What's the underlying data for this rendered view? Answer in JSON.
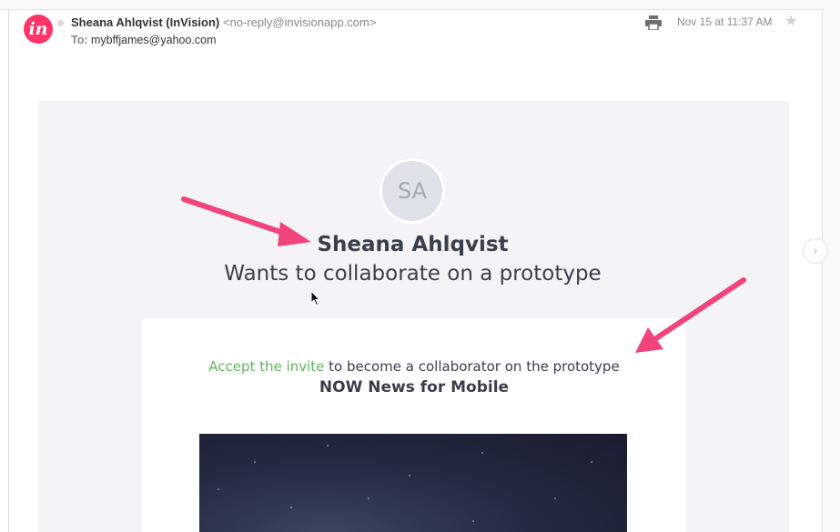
{
  "header": {
    "logo_text": "in",
    "sender_name": "Sheana Ahlqvist (InVision)",
    "sender_email": "<no-reply@invisionapp.com>",
    "to_label": "To:",
    "to_address": "mybffjames@yahoo.com",
    "date": "Nov 15 at 11:37 AM",
    "print_icon": "print-icon",
    "star_icon": "star-icon"
  },
  "body": {
    "avatar_initials": "SA",
    "name": "Sheana Ahlqvist",
    "subtitle": "Wants to collaborate on a prototype",
    "accept_link": "Accept the invite",
    "invite_text": " to become a collaborator on the prototype",
    "prototype_name": "NOW News for Mobile"
  },
  "nav": {
    "next_icon": "chevron-right-icon"
  },
  "colors": {
    "brand": "#ff3366",
    "accent_green": "#5cb85c",
    "annotation_arrow": "#f0447a"
  }
}
